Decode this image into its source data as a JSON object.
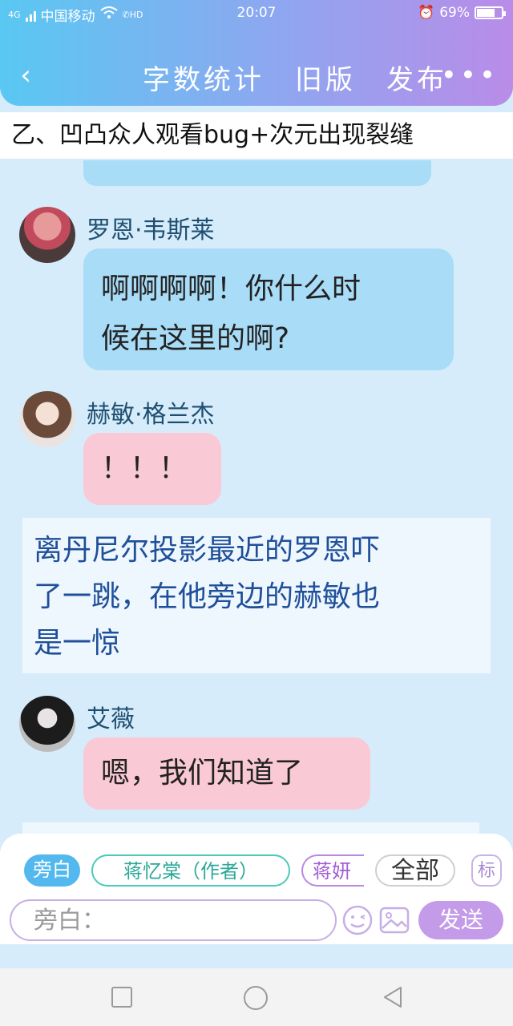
{
  "status_bar": {
    "carrier": "中国移动",
    "network": "4G",
    "hd": "HD",
    "time": "20:07",
    "battery": "69%",
    "battery_level": 0.69
  },
  "header": {
    "back_icon": "chevron-left-icon",
    "actions": [
      "字数统计",
      "旧版",
      "发布"
    ],
    "more_icon": "more-dots-icon"
  },
  "chapter": {
    "title": "乙、凹凸众人观看bug+次元出现裂缝"
  },
  "messages": [
    {
      "sender": "罗恩·韦斯莱",
      "text_lines": [
        "啊啊啊啊！你什么时",
        "候在这里的啊?"
      ],
      "bubble": "blue"
    },
    {
      "sender": "赫敏·格兰杰",
      "text_lines": [
        "！！！"
      ],
      "bubble": "pink"
    },
    {
      "sender": "艾薇",
      "text_lines": [
        "嗯，我们知道了"
      ],
      "bubble": "pink"
    }
  ],
  "narration": {
    "lines": [
      "离丹尼尔投影最近的罗恩吓",
      "了一跳，在他旁边的赫敏也",
      "是一惊"
    ]
  },
  "composer": {
    "chips": {
      "narrator": "旁白",
      "author": "蒋忆棠（作者）",
      "other": "蒋妍",
      "all": "全部",
      "tag": "标"
    },
    "input_placeholder": "旁白：",
    "send": "发送",
    "icons": [
      "emoji-icon",
      "image-icon"
    ]
  },
  "colors": {
    "header_start": "#59c8f2",
    "header_end": "#b98ce8",
    "bubble_blue": "#a9dcf7",
    "bubble_pink": "#f9c9d5",
    "send": "#c49be9"
  }
}
